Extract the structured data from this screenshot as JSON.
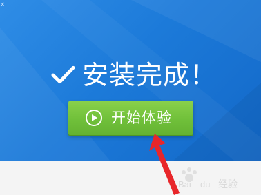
{
  "dialog": {
    "title": "安装完成！",
    "start_button_label": "开始体验",
    "icons": {
      "check": "check-icon",
      "play": "play-circle-icon",
      "close": "close-icon"
    }
  },
  "annotation": {
    "arrow_color": "#e8262a",
    "watermark_text": "Baidu 经验"
  },
  "colors": {
    "panel_blue": "#1c7ad9",
    "button_green": "#70c03a",
    "text_white": "#ffffff"
  }
}
